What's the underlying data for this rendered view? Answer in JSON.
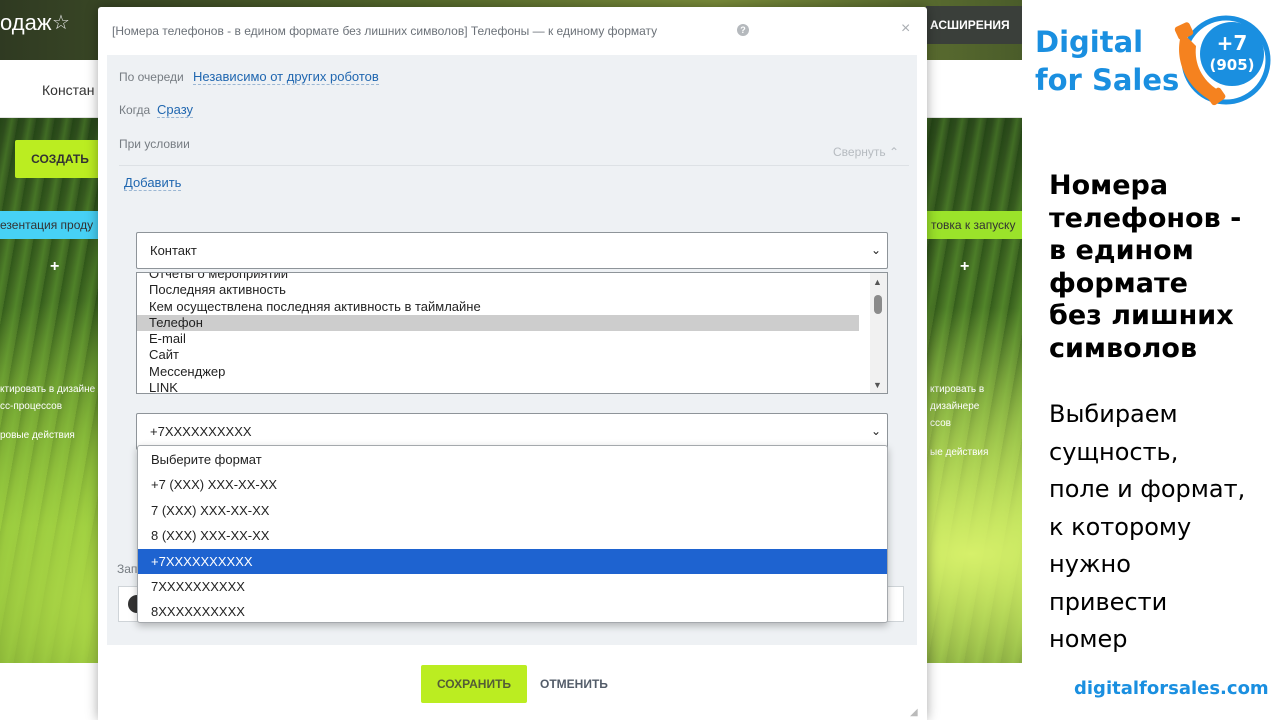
{
  "background": {
    "title_fragment": "одаж",
    "extensions_label": "АСШИРЕНИЯ",
    "subheader_fragment": "Констан",
    "create_button": "СОЗДАТЬ",
    "stage_left": "езентация проду",
    "stage_right": "товка к запуску",
    "plus": "+",
    "left_text": [
      "ктировать в дизайне",
      "сс-процессов",
      "",
      "ровые действия"
    ],
    "right_text": [
      "ктировать в дизайнере",
      "ссов",
      "",
      "ые действия"
    ]
  },
  "dialog": {
    "title": "[Номера телефонов - в едином формате без лишних символов] Телефоны — к единому формату",
    "help_glyph": "?",
    "close_glyph": "×",
    "queue_label": "По очереди",
    "queue_value": "Независимо от других роботов",
    "when_label": "Когда",
    "when_value": "Сразу",
    "condition_label": "При условии",
    "collapse_label": "Свернуть",
    "add_link": "Добавить",
    "entity_select": "Контакт",
    "fields": [
      "Отчеты о мероприятии",
      "Последняя активность",
      "Кем осуществлена последняя активность в таймлайне",
      "Телефон",
      "E-mail",
      "Сайт",
      "Мессенджер",
      "LINK"
    ],
    "selected_field": "Телефон",
    "format_select": "+7XXXXXXXXXX",
    "bottom_label": "Запи",
    "format_options": [
      "Выберите формат",
      "+7 (XXX) XXX-XX-XX",
      "7 (XXX) XXX-XX-XX",
      "8 (XXX) XXX-XX-XX",
      "+7XXXXXXXXXX",
      "7XXXXXXXXXX",
      "8XXXXXXXXXX"
    ],
    "highlighted_option": "+7XXXXXXXXXX",
    "save_button": "СОХРАНИТЬ",
    "cancel_button": "ОТМЕНИТЬ"
  },
  "promo": {
    "brand_line1": "Digital",
    "brand_line2": "for Sales",
    "logo_top": "+7",
    "logo_bottom": "(905)",
    "heading_lines": [
      "Номера",
      "телефонов -",
      "в едином",
      "формате",
      "без лишних",
      "символов"
    ],
    "body_lines": [
      "Выбираем",
      "сущность,",
      "поле и формат,",
      "к которому",
      "нужно",
      "привести",
      "номер"
    ],
    "url": "digitalforsales.com"
  },
  "colors": {
    "accent_green": "#bbed21",
    "link_blue": "#2067b0",
    "brand_blue": "#1a8fe0",
    "logo_orange": "#f5821f",
    "highlight_blue": "#1e63d0"
  }
}
